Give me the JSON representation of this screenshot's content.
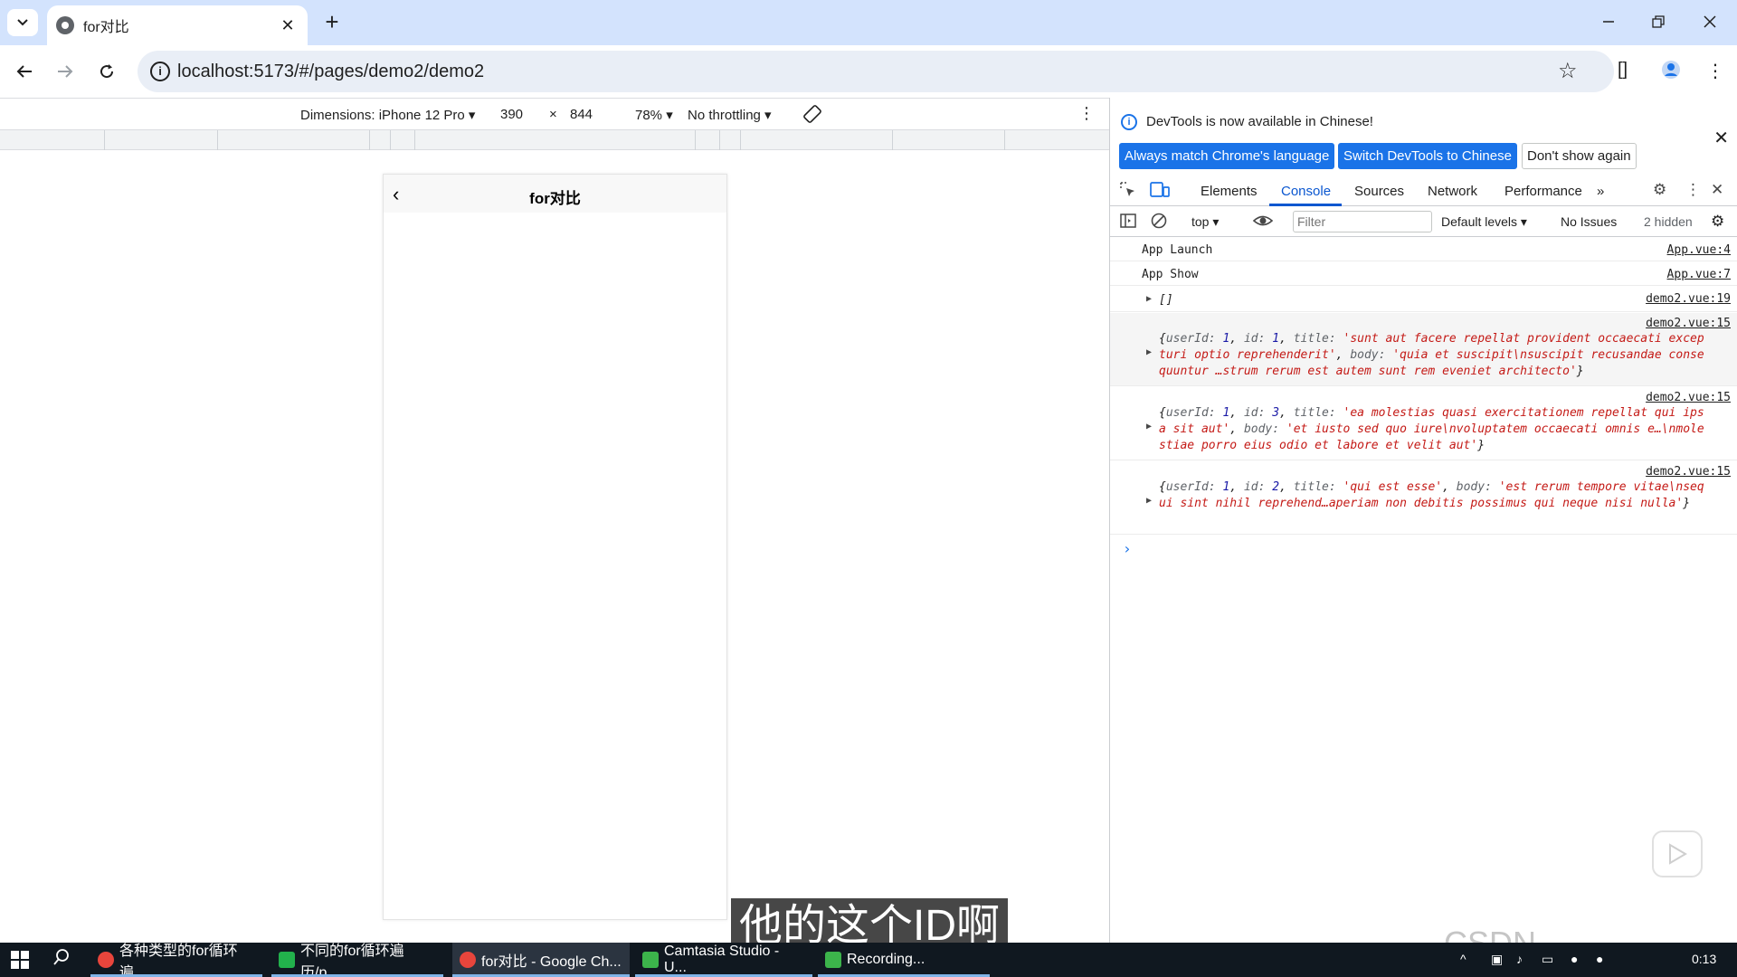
{
  "browser": {
    "tab_title": "for对比",
    "tab_close": "✕",
    "new_tab": "+",
    "url": "localhost:5173/#/pages/demo2/demo2"
  },
  "device_toolbar": {
    "dimensions": "Dimensions: iPhone 12 Pro",
    "width": "390",
    "times": "×",
    "height": "844",
    "zoom": "78%",
    "throttling": "No throttling"
  },
  "phone": {
    "back": "‹",
    "title": "for对比"
  },
  "devtools": {
    "banner_text": "DevTools is now available in Chinese!",
    "btn_match": "Always match Chrome's language",
    "btn_switch": "Switch DevTools to Chinese",
    "btn_dont_show": "Don't show again",
    "tabs": [
      "Elements",
      "Console",
      "Sources",
      "Network",
      "Performance"
    ],
    "more_tabs": "»",
    "context": "top",
    "filter_placeholder": "Filter",
    "levels": "Default levels",
    "issues": "No Issues",
    "hidden": "2 hidden"
  },
  "console": {
    "rows": [
      {
        "msg": "App Launch",
        "src": "App.vue:4"
      },
      {
        "msg": "App Show",
        "src": "App.vue:7"
      },
      {
        "msg": "[]",
        "src": "demo2.vue:19"
      }
    ],
    "objects": [
      {
        "src": "demo2.vue:15",
        "userId": "1",
        "id": "1",
        "title": "'sunt aut facere repellat provident occaecati excepturi optio reprehenderit'",
        "body": "'quia et suscipit\\nsuscipit recusandae consequuntur …strum rerum est autem sunt rem eveniet architecto'"
      },
      {
        "src": "demo2.vue:15",
        "userId": "1",
        "id": "3",
        "title": "'ea molestias quasi exercitationem repellat qui ipsa sit aut'",
        "body": "'et iusto sed quo iure\\nvoluptatem occaecati omnis e…\\nmolestiae porro eius odio et labore et velit aut'"
      },
      {
        "src": "demo2.vue:15",
        "userId": "1",
        "id": "2",
        "title": "'qui est esse'",
        "body": "'est rerum tempore vitae\\nsequi sint nihil reprehend…aperiam non debitis possimus qui neque nisi nulla'"
      }
    ],
    "prompt": "›"
  },
  "subtitle": "他的这个ID啊",
  "watermark": "CSDN @wang_book",
  "taskbar": {
    "items": [
      {
        "label": "各种类型的for循环遍...",
        "color": "#e8453c"
      },
      {
        "label": "不同的for循环遍历/p...",
        "color": "#22b14c"
      },
      {
        "label": "for对比 - Google Ch...",
        "color": "#e8453c"
      },
      {
        "label": "Camtasia Studio - U...",
        "color": "#3cb44b"
      },
      {
        "label": "Recording...",
        "color": "#3cb44b"
      }
    ],
    "time": "0:13"
  },
  "colors": {
    "chrome_frame": "#d3e3fd",
    "accent": "#1a73e8",
    "console_string": "#c41a16",
    "console_number": "#1a1aa6",
    "taskbar": "#101820"
  }
}
